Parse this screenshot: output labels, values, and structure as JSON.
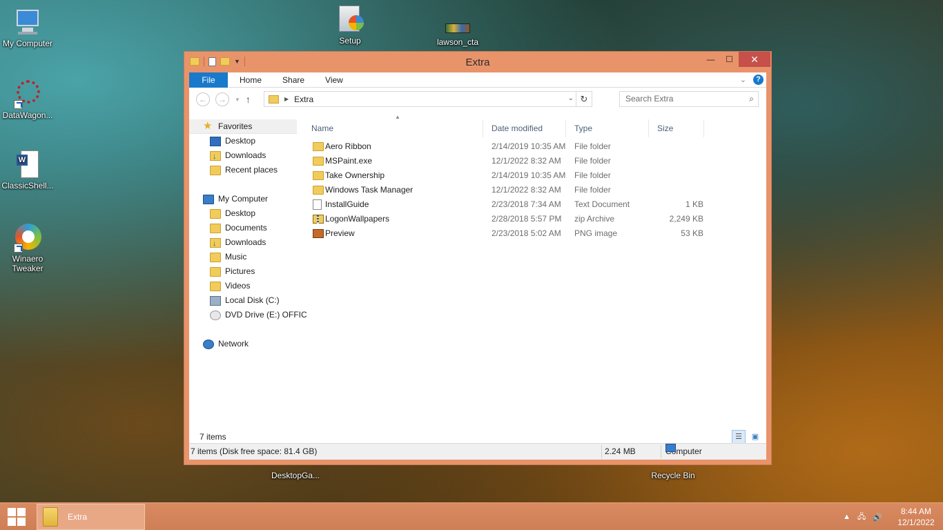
{
  "desktop": {
    "icons": [
      {
        "label": "My Computer"
      },
      {
        "label": "DataWagon..."
      },
      {
        "label": "ClassicShell..."
      },
      {
        "label": "Winaero Tweaker"
      },
      {
        "label": "Setup"
      },
      {
        "label": "lawson_cta"
      },
      {
        "label": "DesktopGa..."
      },
      {
        "label": "Recycle Bin"
      }
    ]
  },
  "window": {
    "title": "Extra",
    "ribbon_tabs": [
      "File",
      "Home",
      "Share",
      "View"
    ],
    "help": "?",
    "address": {
      "folder": "Extra"
    },
    "search": {
      "placeholder": "Search Extra"
    },
    "nav": {
      "favorites_header": "Favorites",
      "favorites": [
        "Desktop",
        "Downloads",
        "Recent places"
      ],
      "computer_header": "My Computer",
      "computer": [
        "Desktop",
        "Documents",
        "Downloads",
        "Music",
        "Pictures",
        "Videos",
        "Local Disk (C:)",
        "DVD Drive (E:) OFFIC"
      ],
      "network": "Network"
    },
    "columns": {
      "name": "Name",
      "date": "Date modified",
      "type": "Type",
      "size": "Size"
    },
    "files": [
      {
        "name": "Aero Ribbon",
        "date": "2/14/2019 10:35 AM",
        "type": "File folder",
        "size": "",
        "icon": "folder-icon"
      },
      {
        "name": "MSPaint.exe",
        "date": "12/1/2022 8:32 AM",
        "type": "File folder",
        "size": "",
        "icon": "folder-icon"
      },
      {
        "name": "Take Ownership",
        "date": "2/14/2019 10:35 AM",
        "type": "File folder",
        "size": "",
        "icon": "folder-icon"
      },
      {
        "name": "Windows Task Manager",
        "date": "12/1/2022 8:32 AM",
        "type": "File folder",
        "size": "",
        "icon": "folder-icon"
      },
      {
        "name": "InstallGuide",
        "date": "2/23/2018 7:34 AM",
        "type": "Text Document",
        "size": "1 KB",
        "icon": "text-file-icon"
      },
      {
        "name": "LogonWallpapers",
        "date": "2/28/2018 5:57 PM",
        "type": "zip Archive",
        "size": "2,249 KB",
        "icon": "zip-icon"
      },
      {
        "name": "Preview",
        "date": "2/23/2018 5:02 AM",
        "type": "PNG image",
        "size": "53 KB",
        "icon": "image-icon"
      }
    ],
    "item_count": "7 items",
    "status": {
      "left": "7 items (Disk free space: 81.4 GB)",
      "size": "2.24 MB",
      "location": "Computer"
    }
  },
  "taskbar": {
    "button_label": "Extra",
    "time": "8:44 AM",
    "date": "12/1/2022"
  }
}
